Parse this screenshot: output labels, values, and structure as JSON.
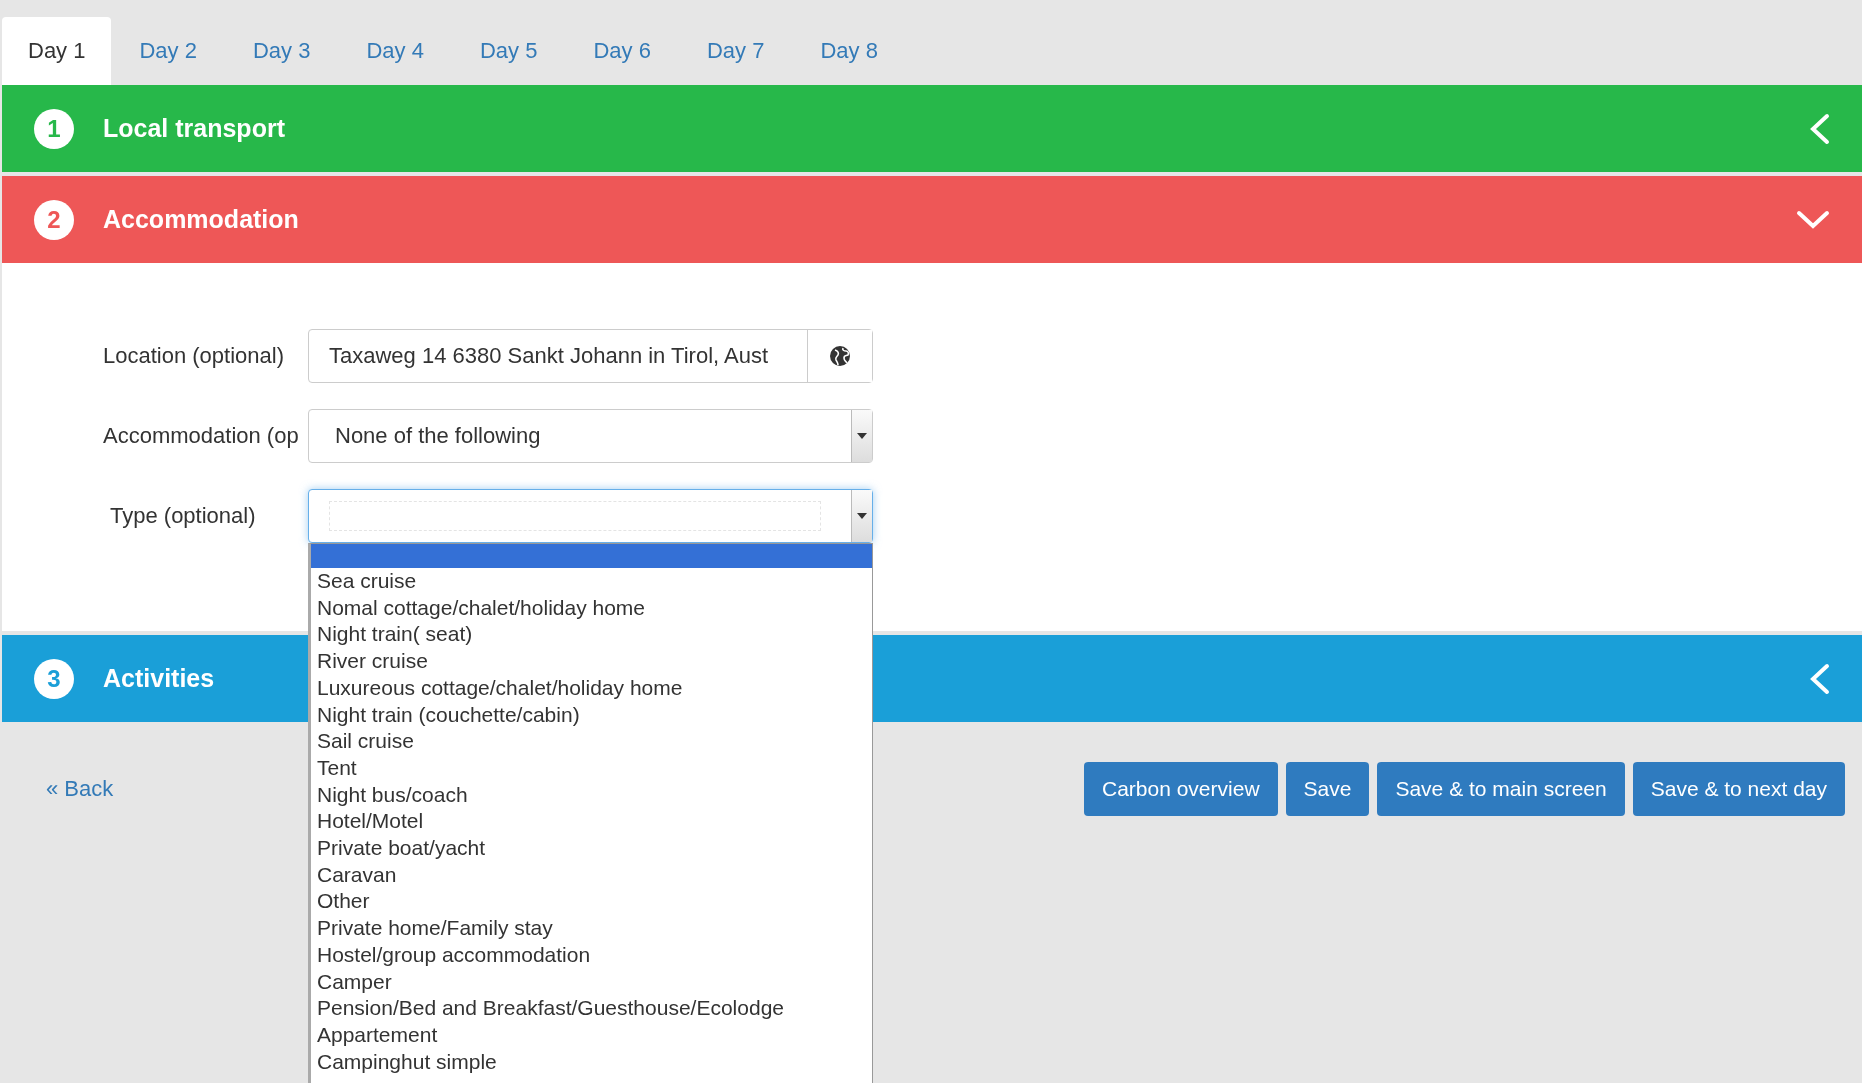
{
  "tabs": [
    {
      "label": "Day 1",
      "selected": true
    },
    {
      "label": "Day 2",
      "selected": false
    },
    {
      "label": "Day 3",
      "selected": false
    },
    {
      "label": "Day 4",
      "selected": false
    },
    {
      "label": "Day 5",
      "selected": false
    },
    {
      "label": "Day 6",
      "selected": false
    },
    {
      "label": "Day 7",
      "selected": false
    },
    {
      "label": "Day 8",
      "selected": false
    }
  ],
  "sections": [
    {
      "number": "1",
      "title": "Local transport",
      "color": "#27b84a",
      "expanded": false
    },
    {
      "number": "2",
      "title": "Accommodation",
      "color": "#ee5757",
      "expanded": true,
      "form": {
        "location": {
          "label": "Location (optional)",
          "value": "Taxaweg 14 6380 Sankt Johann in Tirol, Aust"
        },
        "accommodation": {
          "label": "Accommodation (op",
          "value": "None of the following"
        },
        "type": {
          "label": "Type (optional)",
          "focused": true
        }
      }
    },
    {
      "number": "3",
      "title": "Activities",
      "color": "#1a9fd8",
      "expanded": false
    }
  ],
  "footer": {
    "back_link": "« Back",
    "buttons": [
      "Carbon overview",
      "Save",
      "Save & to main screen",
      "Save & to next day"
    ]
  },
  "type_dropdown": {
    "blank_option": {
      "selected": true
    },
    "options": [
      {
        "label": "Sea cruise",
        "selected": false
      },
      {
        "label": "Nomal cottage/chalet/holiday home",
        "selected": false
      },
      {
        "label": "Night train( seat)",
        "selected": false
      },
      {
        "label": "River cruise",
        "selected": false
      },
      {
        "label": "Luxureous cottage/chalet/holiday home",
        "selected": false
      },
      {
        "label": "Night train (couchette/cabin)",
        "selected": false
      },
      {
        "label": "Sail cruise",
        "selected": false
      },
      {
        "label": "Tent",
        "selected": false
      },
      {
        "label": "Night bus/coach",
        "selected": false
      },
      {
        "label": "Hotel/Motel",
        "selected": false
      },
      {
        "label": "Private boat/yacht",
        "selected": false
      },
      {
        "label": "Caravan",
        "selected": false
      },
      {
        "label": "Other",
        "selected": false
      },
      {
        "label": "Private home/Family stay",
        "selected": false
      },
      {
        "label": "Hostel/group accommodation",
        "selected": false
      },
      {
        "label": "Camper",
        "selected": false
      },
      {
        "label": "Pension/Bed and Breakfast/Guesthouse/Ecolodge",
        "selected": false
      },
      {
        "label": "Appartement",
        "selected": false
      },
      {
        "label": "Campinghut simple",
        "selected": false
      }
    ]
  }
}
